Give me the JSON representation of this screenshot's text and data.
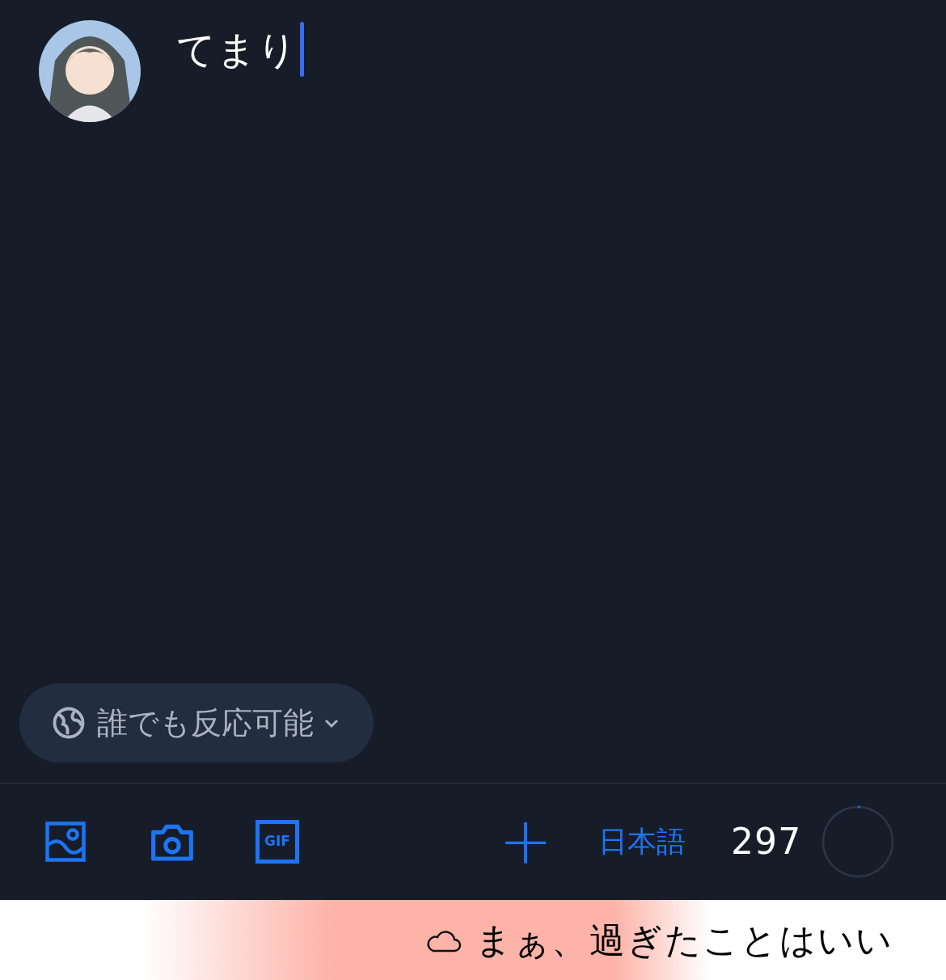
{
  "composer": {
    "value": "てまり"
  },
  "reply_setting": {
    "label": "誰でも反応可能"
  },
  "toolbar": {
    "gif_label": "GIF",
    "add_label": "+",
    "language": "日本語",
    "remaining": "297",
    "counter": {
      "level": 0.01
    }
  },
  "ticker": {
    "text": "まぁ、過ぎたことはいい"
  }
}
